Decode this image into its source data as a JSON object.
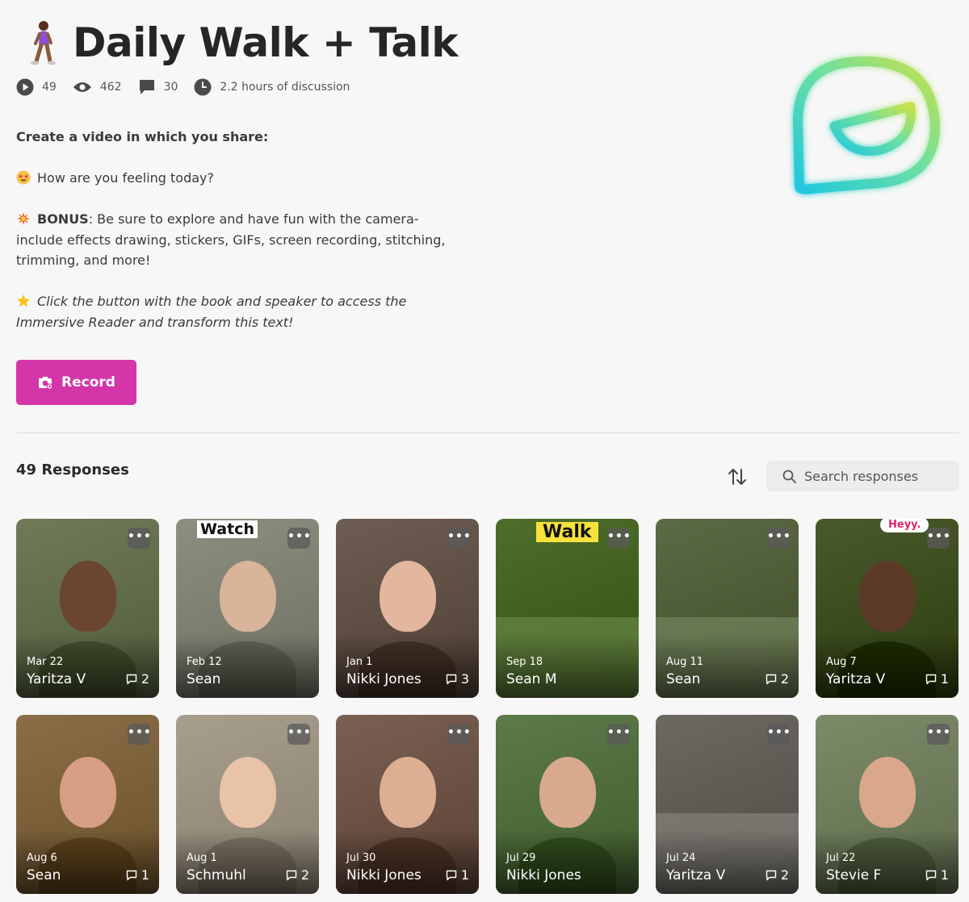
{
  "header": {
    "title": "Daily Walk + Talk"
  },
  "stats": {
    "videos": "49",
    "views": "462",
    "comments": "30",
    "discussion": "2.2 hours of discussion"
  },
  "prompt": {
    "intro": "Create a video in which you share:",
    "feeling": "How are you feeling today?",
    "bonus_label": "BONUS",
    "bonus_text": ": Be sure to explore and have fun with the camera- include effects drawing, stickers, GIFs, screen recording, stitching, trimming, and more!",
    "reader_note": "Click the button with the book and speaker to access the Immersive Reader and transform this text!"
  },
  "record_button": {
    "label": "Record"
  },
  "responses": {
    "title": "49 Responses",
    "search_placeholder": "Search responses"
  },
  "cards": [
    {
      "date": "Mar 22",
      "name": "Yaritza V",
      "comments": "2",
      "more": "•••",
      "bg": "#6f7a58"
    },
    {
      "date": "Feb 12",
      "name": "Sean",
      "comments": "",
      "more": "•••",
      "sticker": "Watch",
      "bg": "#8c8f80"
    },
    {
      "date": "Jan 1",
      "name": "Nikki Jones",
      "comments": "3",
      "more": "•••",
      "bg": "#6e5d52"
    },
    {
      "date": "Sep 18",
      "name": "Sean M",
      "comments": "",
      "more": "•••",
      "sticker": "Walk",
      "bg": "#4f6e2c"
    },
    {
      "date": "Aug 11",
      "name": "Sean",
      "comments": "2",
      "more": "•••",
      "bg": "#5c6b45"
    },
    {
      "date": "Aug 7",
      "name": "Yaritza V",
      "comments": "1",
      "more": "•••",
      "sticker": "Heyy.",
      "bg": "#4a5a2c"
    },
    {
      "date": "Aug 6",
      "name": "Sean",
      "comments": "1",
      "more": "•••",
      "bg": "#8a6e48"
    },
    {
      "date": "Aug 1",
      "name": "Schmuhl",
      "comments": "2",
      "more": "•••",
      "bg": "#a89e8e"
    },
    {
      "date": "Jul 30",
      "name": "Nikki Jones",
      "comments": "1",
      "more": "•••",
      "bg": "#7a6052"
    },
    {
      "date": "Jul 29",
      "name": "Nikki Jones",
      "comments": "",
      "more": "•••",
      "bg": "#5d7a4a"
    },
    {
      "date": "Jul 24",
      "name": "Yaritza V",
      "comments": "2",
      "more": "•••",
      "bg": "#6c6862"
    },
    {
      "date": "Jul 22",
      "name": "Stevie F",
      "comments": "1",
      "more": "•••",
      "bg": "#7c8a6a"
    }
  ],
  "colors": {
    "accent": "#d436a9",
    "logo_gradient_start": "#20c7e0",
    "logo_gradient_end": "#c8e04a"
  },
  "icons": {
    "walker": "person-walking-icon",
    "videos": "play-icon",
    "views": "eye-icon",
    "comments": "comment-icon",
    "time": "clock-icon",
    "feeling": "star-struck-emoji-icon",
    "bonus": "collision-emoji-icon",
    "reader": "star-emoji-icon",
    "record": "camera-icon",
    "sort": "sort-arrows-icon",
    "search": "search-icon",
    "logo": "flip-logo-icon"
  }
}
